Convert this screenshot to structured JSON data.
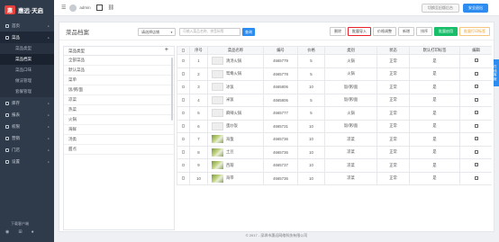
{
  "app": {
    "logo_mark": "惠",
    "brand": "惠远·天启"
  },
  "sidebar": {
    "items": [
      {
        "label": "首页",
        "icon": "home-icon"
      },
      {
        "label": "菜品",
        "icon": "dish-icon",
        "active": true
      },
      {
        "label": "库存",
        "icon": "stock-icon"
      },
      {
        "label": "报表",
        "icon": "report-icon"
      },
      {
        "label": "权限",
        "icon": "permission-icon"
      },
      {
        "label": "营销",
        "icon": "marketing-icon"
      },
      {
        "label": "门店",
        "icon": "store-icon"
      },
      {
        "label": "设置",
        "icon": "settings-icon"
      }
    ],
    "sub_items": [
      "菜品类型",
      "菜品档案",
      "菜品口味",
      "做法管理",
      "套餐管理"
    ],
    "active_sub": "菜品档案",
    "footer_text": "下载客户端"
  },
  "topbar": {
    "user": "admin",
    "switch_label": "切换至旧版后台",
    "logout_label": "安全退出"
  },
  "page": {
    "title": "菜品档案",
    "store_select": "请选择店铺",
    "search_placeholder": "可输入菜品名称、拼音码等",
    "search_button": "查询",
    "actions": [
      "删除",
      "批量导入",
      "价格调整",
      "新增",
      "排序",
      "批量启用",
      "批量打印标签"
    ]
  },
  "categories": {
    "header": "菜品类型",
    "items": [
      "全部菜品",
      "默认菜品",
      "菜单",
      "饭/粥/面",
      "凉菜",
      "热菜",
      "火锅",
      "海鲜",
      "汤类",
      "甜点"
    ]
  },
  "table": {
    "headers": [
      "序号",
      "菜品名称",
      "编号",
      "价格",
      "类别",
      "状态",
      "默认打印标签",
      "编辑"
    ],
    "rows": [
      {
        "no": "1",
        "name": "清汤火锅",
        "code": "4665779",
        "price": "5",
        "category": "火锅",
        "status": "正常",
        "print": "是",
        "photo": false
      },
      {
        "no": "2",
        "name": "鸳鸯火锅",
        "code": "4665778",
        "price": "5",
        "category": "火锅",
        "status": "正常",
        "print": "是",
        "photo": false
      },
      {
        "no": "3",
        "name": "冰饭",
        "code": "4665806",
        "price": "10",
        "category": "饭/粥/面",
        "status": "正常",
        "print": "是",
        "photo": false
      },
      {
        "no": "4",
        "name": "米饭",
        "code": "4665806",
        "price": "5",
        "category": "饭/粥/面",
        "status": "正常",
        "print": "是",
        "photo": false
      },
      {
        "no": "5",
        "name": "麻辣火锅",
        "code": "4665777",
        "price": "5",
        "category": "火锅",
        "status": "正常",
        "print": "是",
        "photo": false
      },
      {
        "no": "6",
        "name": "蛋炒饭",
        "code": "4665731",
        "price": "10",
        "category": "饭/粥/面",
        "status": "正常",
        "print": "是",
        "photo": false
      },
      {
        "no": "7",
        "name": "海蜇",
        "code": "4665736",
        "price": "10",
        "category": "凉菜",
        "status": "正常",
        "print": "是",
        "photo": true
      },
      {
        "no": "8",
        "name": "土豆",
        "code": "4665736",
        "price": "10",
        "category": "凉菜",
        "status": "正常",
        "print": "是",
        "photo": true
      },
      {
        "no": "9",
        "name": "西葫",
        "code": "4665737",
        "price": "10",
        "category": "凉菜",
        "status": "正常",
        "print": "是",
        "photo": true
      },
      {
        "no": "10",
        "name": "海带",
        "code": "4665736",
        "price": "10",
        "category": "凉菜",
        "status": "正常",
        "print": "是",
        "photo": true
      }
    ]
  },
  "side_tab": "在线客服",
  "footer": {
    "copyright": "© 2017 - 深圳市惠远网络科技有限公司"
  },
  "colors": {
    "primary": "#2d8cf0",
    "highlight": "#e8232a",
    "success": "#19be6b",
    "sidebar_bg": "#2f3a4a"
  }
}
